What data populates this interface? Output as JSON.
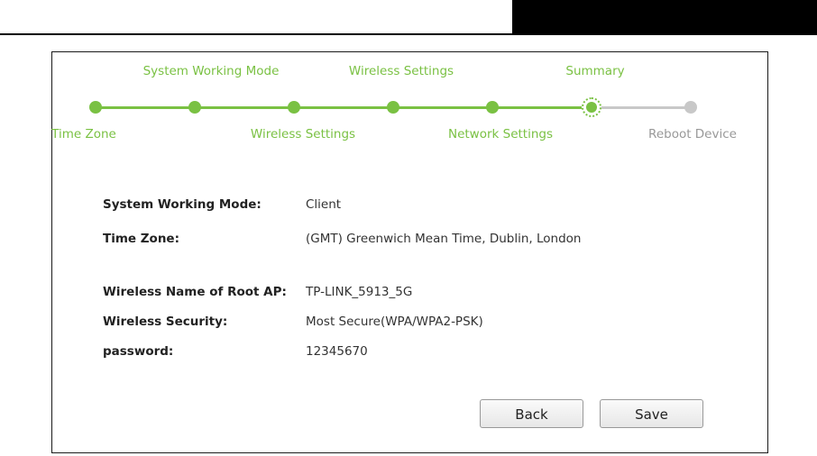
{
  "wizard": {
    "steps": [
      {
        "label": "Time Zone",
        "state": "done"
      },
      {
        "label": "System Working Mode",
        "state": "done"
      },
      {
        "label": "Wireless Settings",
        "state": "done"
      },
      {
        "label": "Wireless Settings",
        "state": "done"
      },
      {
        "label": "Network Settings",
        "state": "done"
      },
      {
        "label": "Summary",
        "state": "current"
      },
      {
        "label": "Reboot Device",
        "state": "todo"
      }
    ],
    "accent_color": "#7ac143",
    "inactive_color": "#c8c8c8"
  },
  "summary": {
    "rows": [
      {
        "label": "System Working Mode:",
        "value": "Client"
      },
      {
        "label": "Time Zone:",
        "value": "(GMT) Greenwich Mean Time, Dublin, London"
      },
      {
        "label": "Wireless Name of Root AP:",
        "value": "TP-LINK_5913_5G"
      },
      {
        "label": "Wireless Security:",
        "value": "Most Secure(WPA/WPA2-PSK)"
      },
      {
        "label": "password:",
        "value": "12345670"
      }
    ]
  },
  "buttons": {
    "back_label": "Back",
    "save_label": "Save"
  }
}
